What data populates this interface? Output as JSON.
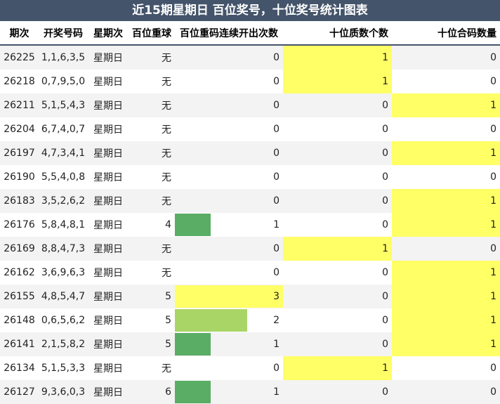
{
  "title": "近15期星期日 百位奖号，十位奖号统计图表",
  "colors": {
    "header_bg": "#44546a",
    "highlight": "#ffff66",
    "bar_dark": "#5aad64",
    "bar_light": "#a9d566",
    "row_alt": "#f3f3f3"
  },
  "chart_data": {
    "type": "table",
    "columns": [
      "期次",
      "开奖号码",
      "星期次",
      "百位重球",
      "百位重码连续开出次数",
      "十位质数个数",
      "十位合码数量"
    ],
    "rows": [
      {
        "issue": "26225",
        "numbers": "1,1,6,3,5",
        "weekday": "星期日",
        "hundreds_repeat": "无",
        "streak": "0",
        "tens_prime": "1",
        "tens_composite": "0",
        "streak_bar": "none",
        "prime_hl": true,
        "comp_hl": false
      },
      {
        "issue": "26218",
        "numbers": "0,7,9,5,0",
        "weekday": "星期日",
        "hundreds_repeat": "无",
        "streak": "0",
        "tens_prime": "1",
        "tens_composite": "0",
        "streak_bar": "none",
        "prime_hl": true,
        "comp_hl": false
      },
      {
        "issue": "26211",
        "numbers": "5,1,5,4,3",
        "weekday": "星期日",
        "hundreds_repeat": "无",
        "streak": "0",
        "tens_prime": "0",
        "tens_composite": "1",
        "streak_bar": "none",
        "prime_hl": false,
        "comp_hl": true
      },
      {
        "issue": "26204",
        "numbers": "6,7,4,0,7",
        "weekday": "星期日",
        "hundreds_repeat": "无",
        "streak": "0",
        "tens_prime": "0",
        "tens_composite": "0",
        "streak_bar": "none",
        "prime_hl": false,
        "comp_hl": false
      },
      {
        "issue": "26197",
        "numbers": "4,7,3,4,1",
        "weekday": "星期日",
        "hundreds_repeat": "无",
        "streak": "0",
        "tens_prime": "0",
        "tens_composite": "1",
        "streak_bar": "none",
        "prime_hl": false,
        "comp_hl": true
      },
      {
        "issue": "26190",
        "numbers": "5,5,4,0,8",
        "weekday": "星期日",
        "hundreds_repeat": "无",
        "streak": "0",
        "tens_prime": "0",
        "tens_composite": "0",
        "streak_bar": "none",
        "prime_hl": false,
        "comp_hl": false
      },
      {
        "issue": "26183",
        "numbers": "3,5,2,6,2",
        "weekday": "星期日",
        "hundreds_repeat": "无",
        "streak": "0",
        "tens_prime": "0",
        "tens_composite": "1",
        "streak_bar": "none",
        "prime_hl": false,
        "comp_hl": true
      },
      {
        "issue": "26176",
        "numbers": "5,8,4,8,1",
        "weekday": "星期日",
        "hundreds_repeat": "4",
        "streak": "1",
        "tens_prime": "0",
        "tens_composite": "1",
        "streak_bar": "dark",
        "prime_hl": false,
        "comp_hl": true
      },
      {
        "issue": "26169",
        "numbers": "8,8,4,7,3",
        "weekday": "星期日",
        "hundreds_repeat": "无",
        "streak": "0",
        "tens_prime": "1",
        "tens_composite": "0",
        "streak_bar": "none",
        "prime_hl": true,
        "comp_hl": false
      },
      {
        "issue": "26162",
        "numbers": "3,6,9,6,3",
        "weekday": "星期日",
        "hundreds_repeat": "无",
        "streak": "0",
        "tens_prime": "0",
        "tens_composite": "1",
        "streak_bar": "none",
        "prime_hl": false,
        "comp_hl": true
      },
      {
        "issue": "26155",
        "numbers": "4,8,5,4,7",
        "weekday": "星期日",
        "hundreds_repeat": "5",
        "streak": "3",
        "tens_prime": "0",
        "tens_composite": "1",
        "streak_bar": "yellow",
        "prime_hl": false,
        "comp_hl": true
      },
      {
        "issue": "26148",
        "numbers": "0,6,5,6,2",
        "weekday": "星期日",
        "hundreds_repeat": "5",
        "streak": "2",
        "tens_prime": "0",
        "tens_composite": "1",
        "streak_bar": "light",
        "prime_hl": false,
        "comp_hl": true
      },
      {
        "issue": "26141",
        "numbers": "2,1,5,8,2",
        "weekday": "星期日",
        "hundreds_repeat": "5",
        "streak": "1",
        "tens_prime": "0",
        "tens_composite": "1",
        "streak_bar": "dark",
        "prime_hl": false,
        "comp_hl": true
      },
      {
        "issue": "26134",
        "numbers": "5,1,5,3,3",
        "weekday": "星期日",
        "hundreds_repeat": "无",
        "streak": "0",
        "tens_prime": "1",
        "tens_composite": "0",
        "streak_bar": "none",
        "prime_hl": true,
        "comp_hl": false
      },
      {
        "issue": "26127",
        "numbers": "9,3,6,0,3",
        "weekday": "星期日",
        "hundreds_repeat": "6",
        "streak": "1",
        "tens_prime": "0",
        "tens_composite": "0",
        "streak_bar": "dark",
        "prime_hl": false,
        "comp_hl": false
      }
    ]
  }
}
